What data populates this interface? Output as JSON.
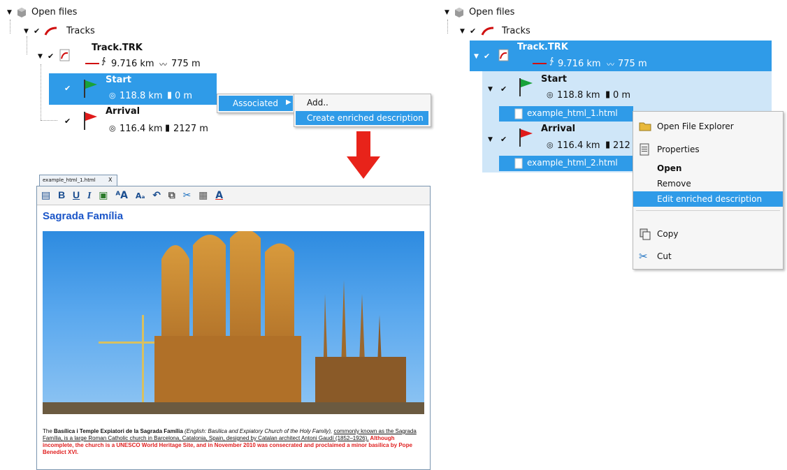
{
  "left_tree": {
    "open_files": "Open files",
    "tracks": "Tracks",
    "track_name": "Track.TRK",
    "track_distance": "9.716 km",
    "track_elevation": "775 m",
    "start": {
      "name": "Start",
      "distance": "118.8 km",
      "elevation": "0 m"
    },
    "arrival": {
      "name": "Arrival",
      "distance": "116.4 km",
      "elevation": "2127 m"
    }
  },
  "left_menu": {
    "associated": "Associated",
    "add": "Add..",
    "create_enriched": "Create enriched description"
  },
  "editor": {
    "tab_label": "example_html_1.html",
    "tab_close": "X",
    "heading": "Sagrada Família",
    "para_1": "The ",
    "para_bold": "Basílica i Temple Expiatori de la Sagrada Família",
    "para_italic": " (English: Basilica and Expiatory Church of the Holy Family),",
    "para_underlined": "commonly known as the Sagrada Família, is a large Roman Catholic church in Barcelona, Catalonia, Spain, designed by Catalan architect Antoni Gaudí (1852–1926).",
    "para_red": " Although incomplete, the church is a UNESCO World Heritage Site, and in November 2010 was consecrated and proclaimed a minor basilica by Pope Benedict XVI."
  },
  "right_tree": {
    "open_files": "Open files",
    "tracks": "Tracks",
    "track_name": "Track.TRK",
    "track_distance": "9.716 km",
    "track_elevation": "775 m",
    "start": {
      "name": "Start",
      "distance": "118.8 km",
      "elevation": "0 m"
    },
    "file_1": "example_html_1.html",
    "arrival": {
      "name": "Arrival",
      "distance": "116.4 km",
      "elevation": "212"
    },
    "file_2": "example_html_2.html"
  },
  "right_menu": {
    "open_explorer": "Open File Explorer",
    "properties": "Properties",
    "open": "Open",
    "remove": "Remove",
    "edit_enriched": "Edit enriched description",
    "copy": "Copy",
    "cut": "Cut"
  },
  "colors": {
    "selection": "#2f9be8",
    "light_selection": "#cfe6f8",
    "arrow": "#e8231a"
  }
}
